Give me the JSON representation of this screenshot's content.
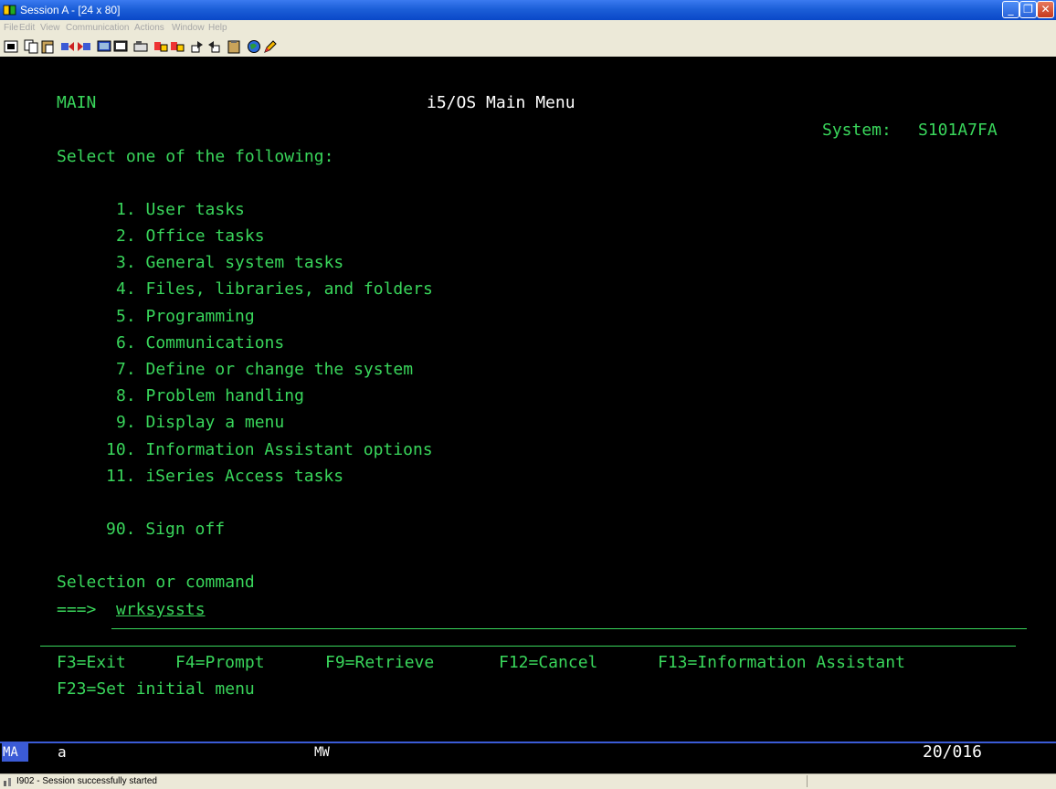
{
  "window": {
    "title": "Session A - [24 x 80]"
  },
  "menubar": [
    "File",
    "Edit",
    "View",
    "Communication",
    "Actions",
    "Window",
    "Help"
  ],
  "terminal": {
    "screen_id": "MAIN",
    "title": "i5/OS Main Menu",
    "system_label": "System:",
    "system_name": "S101A7FA",
    "prompt": "Select one of the following:",
    "options": [
      "1. User tasks",
      "2. Office tasks",
      "3. General system tasks",
      "4. Files, libraries, and folders",
      "5. Programming",
      "6. Communications",
      "7. Define or change the system",
      "8. Problem handling",
      "9. Display a menu",
      "10. Information Assistant options",
      "11. iSeries Access tasks"
    ],
    "signoff_option": "90. Sign off",
    "command_label": "Selection or command",
    "command_prompt": "===>",
    "command_value": "wrksysst",
    "command_cursor_char": "s",
    "fkeys_line1": [
      "F3=Exit",
      "F4=Prompt",
      "F9=Retrieve",
      "F12=Cancel",
      "F13=Information Assistant"
    ],
    "fkeys_line2": "F23=Set initial menu"
  },
  "oia": {
    "indicator": "MA",
    "session": "a",
    "mode": "MW",
    "cursor_position": "20/016"
  },
  "statusbar": {
    "message": "I902 - Session successfully started"
  },
  "colors": {
    "terminal_text": "#39d65b",
    "terminal_bg": "#000000",
    "titlebar": "#0a48c8"
  }
}
